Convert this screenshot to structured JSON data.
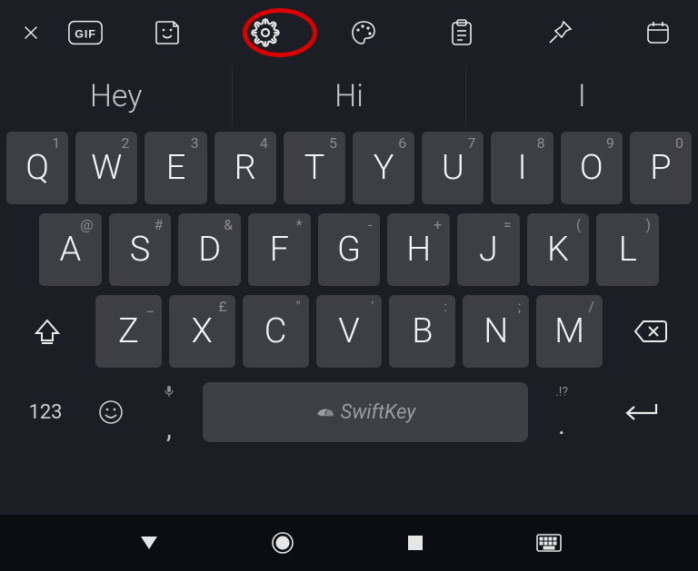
{
  "toolbar": {
    "close_name": "close",
    "gif_label": "GIF",
    "icons": [
      "sticker-icon",
      "settings-icon",
      "themes-icon",
      "clipboard-icon",
      "pin-icon",
      "calendar-icon"
    ],
    "settings_highlighted": true
  },
  "suggestions": [
    "Hey",
    "Hi",
    "I"
  ],
  "keyboard": {
    "row1": [
      {
        "main": "Q",
        "sub": "1"
      },
      {
        "main": "W",
        "sub": "2"
      },
      {
        "main": "E",
        "sub": "3"
      },
      {
        "main": "R",
        "sub": "4"
      },
      {
        "main": "T",
        "sub": "5"
      },
      {
        "main": "Y",
        "sub": "6"
      },
      {
        "main": "U",
        "sub": "7"
      },
      {
        "main": "I",
        "sub": "8"
      },
      {
        "main": "O",
        "sub": "9"
      },
      {
        "main": "P",
        "sub": "0"
      }
    ],
    "row2": [
      {
        "main": "A",
        "sub": "@"
      },
      {
        "main": "S",
        "sub": "#"
      },
      {
        "main": "D",
        "sub": "&"
      },
      {
        "main": "F",
        "sub": "*"
      },
      {
        "main": "G",
        "sub": "-"
      },
      {
        "main": "H",
        "sub": "+"
      },
      {
        "main": "J",
        "sub": "="
      },
      {
        "main": "K",
        "sub": "("
      },
      {
        "main": "L",
        "sub": ")"
      }
    ],
    "row3": [
      {
        "main": "Z",
        "sub": "_"
      },
      {
        "main": "X",
        "sub": "£"
      },
      {
        "main": "C",
        "sub": "\""
      },
      {
        "main": "V",
        "sub": "'"
      },
      {
        "main": "B",
        "sub": ":"
      },
      {
        "main": "N",
        "sub": ";"
      },
      {
        "main": "M",
        "sub": "/"
      }
    ],
    "numeric_label": "123",
    "comma_sub": "🎤",
    "comma_main": ",",
    "period_sub": ".!?",
    "period_main": ".",
    "space_label": "SwiftKey"
  }
}
